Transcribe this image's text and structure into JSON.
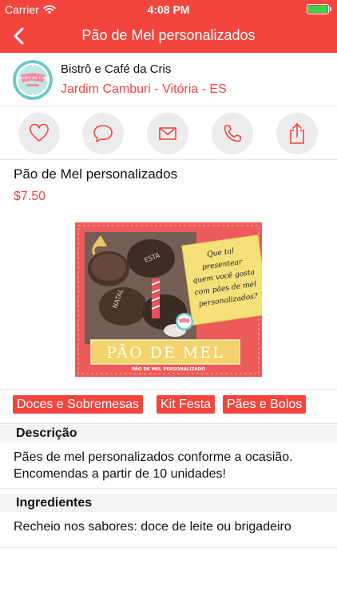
{
  "status_bar": {
    "carrier": "Carrier",
    "time": "4:08 PM"
  },
  "nav": {
    "title": "Pão de Mel personalizados"
  },
  "store": {
    "name": "Bistrô e Café da Cris",
    "location": "Jardim Camburi - Vitória - ES",
    "logo_text": "Bistrô da Cris"
  },
  "actions": [
    {
      "icon": "heart-icon"
    },
    {
      "icon": "chat-bubble-icon"
    },
    {
      "icon": "envelope-icon"
    },
    {
      "icon": "phone-icon"
    },
    {
      "icon": "share-icon"
    }
  ],
  "product": {
    "title": "Pão de Mel personalizados",
    "price": "$7.50",
    "image": {
      "note_lines": [
        "Que tal",
        "presentear",
        "quem você gosta",
        "com pães de mel",
        "personalizados?"
      ],
      "banner": "PÃO DE MEL",
      "subtitle": "PÃO DE MEL PERSONALIZADO"
    }
  },
  "tags": [
    "Doces e Sobremesas",
    "Kit Festa",
    "Pães e Bolos"
  ],
  "description": {
    "heading": "Descrição",
    "text": "Pães de mel personalizados conforme a ocasião. Encomendas a partir de 10 unidades!"
  },
  "ingredients": {
    "heading": "Ingredientes",
    "text": "Recheio nos sabores: doce de leite ou brigadeiro"
  },
  "colors": {
    "accent": "#f2453e",
    "icon_button_bg": "#ececec"
  }
}
